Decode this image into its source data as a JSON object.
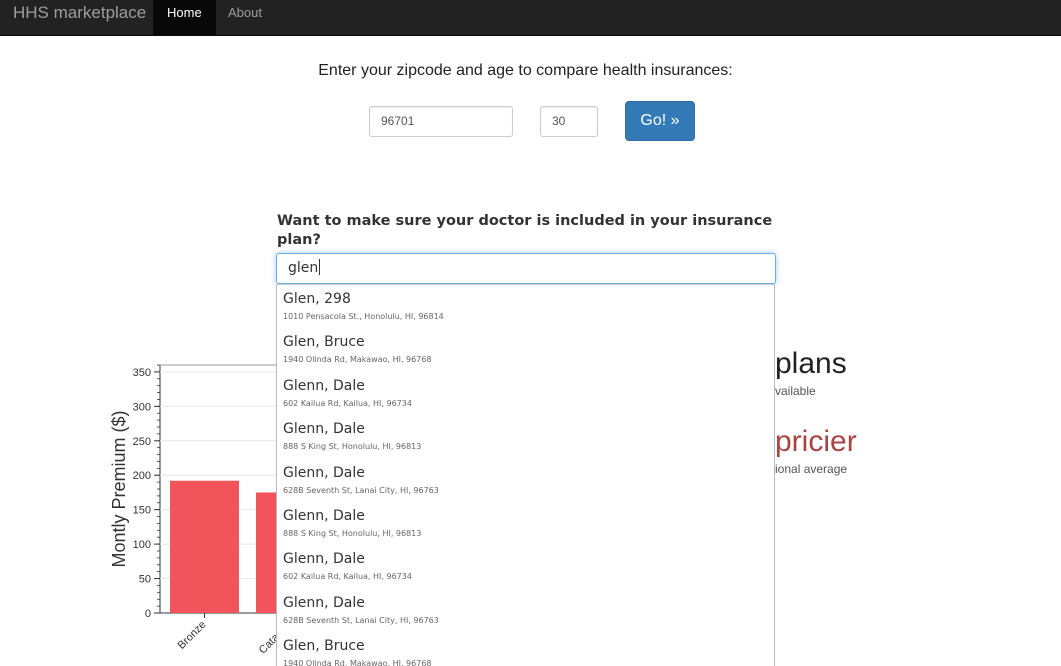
{
  "nav": {
    "brand": "HHS marketplace",
    "items": [
      {
        "label": "Home",
        "active": true
      },
      {
        "label": "About",
        "active": false
      }
    ]
  },
  "form": {
    "prompt": "Enter your zipcode and age to compare health insurances:",
    "zip_value": "96701",
    "age_value": "30",
    "go_label": "Go! »"
  },
  "doctor_search": {
    "question": "Want to make sure your doctor is included in your insurance plan?",
    "value": "glen",
    "results": [
      {
        "name": "Glen, 298",
        "address": "1010 Pensacola St., Honolulu, HI, 96814"
      },
      {
        "name": "Glen, Bruce",
        "address": "1940 Olinda Rd, Makawao, HI, 96768"
      },
      {
        "name": "Glenn, Dale",
        "address": "602 Kailua Rd, Kailua, HI, 96734"
      },
      {
        "name": "Glenn, Dale",
        "address": "888 S King St, Honolulu, HI, 96813"
      },
      {
        "name": "Glenn, Dale",
        "address": "628B Seventh St, Lanai City, HI, 96763"
      },
      {
        "name": "Glenn, Dale",
        "address": "888 S King St, Honolulu, HI, 96813"
      },
      {
        "name": "Glenn, Dale",
        "address": "602 Kailua Rd, Kailua, HI, 96734"
      },
      {
        "name": "Glenn, Dale",
        "address": "628B Seventh St, Lanai City, HI, 96763"
      },
      {
        "name": "Glen, Bruce",
        "address": "1940 Olinda Rd, Makawao, HI, 96768"
      }
    ]
  },
  "stats": {
    "plans_big": "plans",
    "plans_small": "vailable",
    "pricier_big": "pricier",
    "pricier_small": "ional average"
  },
  "chart_data": {
    "type": "bar",
    "ylabel": "Montly Premium ($)",
    "ylim": [
      0,
      360
    ],
    "yticks": [
      0,
      50,
      100,
      150,
      200,
      250,
      300,
      350
    ],
    "categories": [
      "Bronze",
      "Catastro"
    ],
    "values": [
      192,
      175
    ],
    "bar_color": "#f2545b"
  },
  "colors": {
    "navbar": "#222222",
    "primary_button": "#337ab7",
    "pricier_text": "#a94442"
  }
}
